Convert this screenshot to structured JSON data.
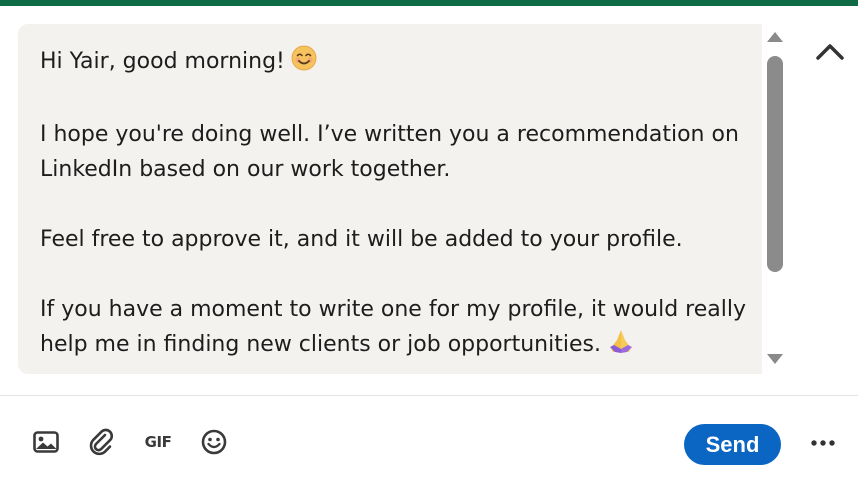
{
  "compose": {
    "paragraphs": [
      {
        "text": "Hi Yair, good morning!",
        "emoji": "smiling-face-emoji"
      },
      {
        "text": "I hope you're doing well. I’ve written you a recommendation on\nLinkedIn based on our work together."
      },
      {
        "text": "Feel free to approve it, and it will be added to your profile."
      },
      {
        "text": "If you have a moment to write one for my profile, it would really\nhelp me in finding new clients or job opportunities.",
        "emoji": "folded-hands-emoji"
      }
    ]
  },
  "toolbar": {
    "icons": [
      "image-icon",
      "attachment-icon",
      "gif-icon",
      "emoji-icon"
    ],
    "gif_label": "GIF",
    "send_label": "Send",
    "more_icon": "more-options-icon",
    "collapse_icon": "chevron-up-icon"
  },
  "colors": {
    "accent": "#0a66c2",
    "top_bar": "#0f6b46",
    "message_background": "#f3f2ef"
  }
}
